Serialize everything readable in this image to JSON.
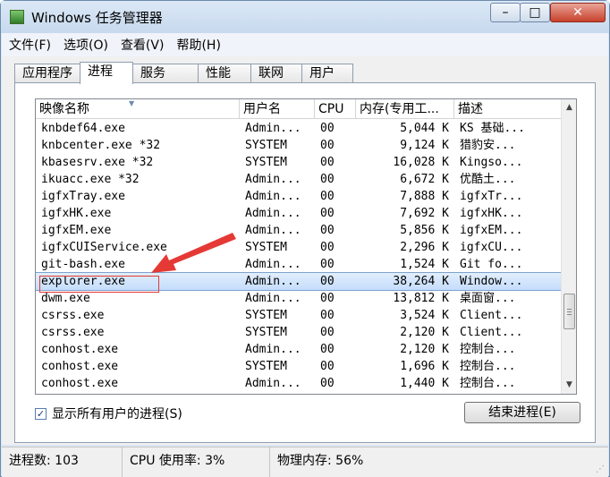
{
  "window": {
    "title": "Windows 任务管理器"
  },
  "menu": [
    "文件(F)",
    "选项(O)",
    "查看(V)",
    "帮助(H)"
  ],
  "tabs": [
    "应用程序",
    "进程",
    "服务",
    "性能",
    "联网",
    "用户"
  ],
  "active_tab": "进程",
  "columns": [
    "映像名称",
    "用户名",
    "CPU",
    "内存(专用工...",
    "描述"
  ],
  "processes": [
    {
      "name": "knbdef64.exe",
      "user": "Admin...",
      "cpu": "00",
      "mem": "5,044 K",
      "desc": "KS 基础..."
    },
    {
      "name": "knbcenter.exe *32",
      "user": "SYSTEM",
      "cpu": "00",
      "mem": "9,124 K",
      "desc": "猎豹安..."
    },
    {
      "name": "kbasesrv.exe *32",
      "user": "SYSTEM",
      "cpu": "00",
      "mem": "16,028 K",
      "desc": "Kingso..."
    },
    {
      "name": "ikuacc.exe *32",
      "user": "Admin...",
      "cpu": "00",
      "mem": "6,672 K",
      "desc": "优酷土..."
    },
    {
      "name": "igfxTray.exe",
      "user": "Admin...",
      "cpu": "00",
      "mem": "7,888 K",
      "desc": "igfxTr..."
    },
    {
      "name": "igfxHK.exe",
      "user": "Admin...",
      "cpu": "00",
      "mem": "7,692 K",
      "desc": "igfxHK..."
    },
    {
      "name": "igfxEM.exe",
      "user": "Admin...",
      "cpu": "00",
      "mem": "5,856 K",
      "desc": "igfxEM..."
    },
    {
      "name": "igfxCUIService.exe",
      "user": "SYSTEM",
      "cpu": "00",
      "mem": "2,296 K",
      "desc": "igfxCU..."
    },
    {
      "name": "git-bash.exe",
      "user": "Admin...",
      "cpu": "00",
      "mem": "1,524 K",
      "desc": "Git fo..."
    },
    {
      "name": "explorer.exe",
      "user": "Admin...",
      "cpu": "00",
      "mem": "38,264 K",
      "desc": "Window...",
      "selected": true
    },
    {
      "name": "dwm.exe",
      "user": "Admin...",
      "cpu": "00",
      "mem": "13,812 K",
      "desc": "桌面窗..."
    },
    {
      "name": "csrss.exe",
      "user": "SYSTEM",
      "cpu": "00",
      "mem": "3,524 K",
      "desc": "Client..."
    },
    {
      "name": "csrss.exe",
      "user": "SYSTEM",
      "cpu": "00",
      "mem": "2,120 K",
      "desc": "Client..."
    },
    {
      "name": "conhost.exe",
      "user": "Admin...",
      "cpu": "00",
      "mem": "2,120 K",
      "desc": "控制台..."
    },
    {
      "name": "conhost.exe",
      "user": "SYSTEM",
      "cpu": "00",
      "mem": "1,696 K",
      "desc": "控制台..."
    },
    {
      "name": "conhost.exe",
      "user": "Admin...",
      "cpu": "00",
      "mem": "1,440 K",
      "desc": "控制台..."
    }
  ],
  "show_all_users": {
    "label": "显示所有用户的进程(S)",
    "checked": true
  },
  "end_process_button": "结束进程(E)",
  "status": {
    "processes": "进程数: 103",
    "cpu": "CPU 使用率: 3%",
    "memory": "物理内存: 56%"
  },
  "icons": {
    "app": "task-manager-icon",
    "minimize": "minimize-icon",
    "maximize": "maximize-icon",
    "close": "close-icon",
    "sort": "sort-arrow-icon",
    "annotation": "red-arrow-annotation"
  }
}
